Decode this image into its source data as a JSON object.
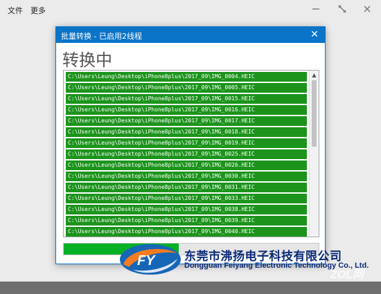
{
  "menubar": {
    "file_label": "文件",
    "more_label": "更多"
  },
  "window_controls": {
    "minimize_icon": "minimize-icon",
    "restore_icon": "restore-icon",
    "close_icon": "close-icon"
  },
  "dialog": {
    "title": "批量转换 - 已启用2线程",
    "close_glyph": "✕",
    "status": "转换中",
    "files": [
      "C:\\Users\\Leung\\Desktop\\iPhone8plus\\2017_09\\IMG_0004.HEIC",
      "C:\\Users\\Leung\\Desktop\\iPhone8plus\\2017_09\\IMG_0005.HEIC",
      "C:\\Users\\Leung\\Desktop\\iPhone8plus\\2017_09\\IMG_0015.HEIC",
      "C:\\Users\\Leung\\Desktop\\iPhone8plus\\2017_09\\IMG_0016.HEIC",
      "C:\\Users\\Leung\\Desktop\\iPhone8plus\\2017_09\\IMG_0017.HEIC",
      "C:\\Users\\Leung\\Desktop\\iPhone8plus\\2017_09\\IMG_0018.HEIC",
      "C:\\Users\\Leung\\Desktop\\iPhone8plus\\2017_09\\IMG_0019.HEIC",
      "C:\\Users\\Leung\\Desktop\\iPhone8plus\\2017_09\\IMG_0025.HEIC",
      "C:\\Users\\Leung\\Desktop\\iPhone8plus\\2017_09\\IMG_0026.HEIC",
      "C:\\Users\\Leung\\Desktop\\iPhone8plus\\2017_09\\IMG_0030.HEIC",
      "C:\\Users\\Leung\\Desktop\\iPhone8plus\\2017_09\\IMG_0031.HEIC",
      "C:\\Users\\Leung\\Desktop\\iPhone8plus\\2017_09\\IMG_0033.HEIC",
      "C:\\Users\\Leung\\Desktop\\iPhone8plus\\2017_09\\IMG_0038.HEIC",
      "C:\\Users\\Leung\\Desktop\\iPhone8plus\\2017_09\\IMG_0039.HEIC",
      "C:\\Users\\Leung\\Desktop\\iPhone8plus\\2017_09\\IMG_0040.HEIC"
    ],
    "progress_fraction": 0.45
  },
  "watermark": {
    "logo_letters": "FY",
    "company_cn": "东莞市沸扬电子科技有限公司",
    "company_en": "Dongguan Feiyang Electronic Technology Co., Ltd.",
    "site_mark": "ZOL网"
  },
  "colors": {
    "accent_blue": "#0a74c8",
    "row_green": "#1c941c",
    "progress_green": "#06b025",
    "logo_orange": "#f47c20",
    "logo_blue": "#1666b8",
    "watermark_text": "#0b2a78"
  }
}
